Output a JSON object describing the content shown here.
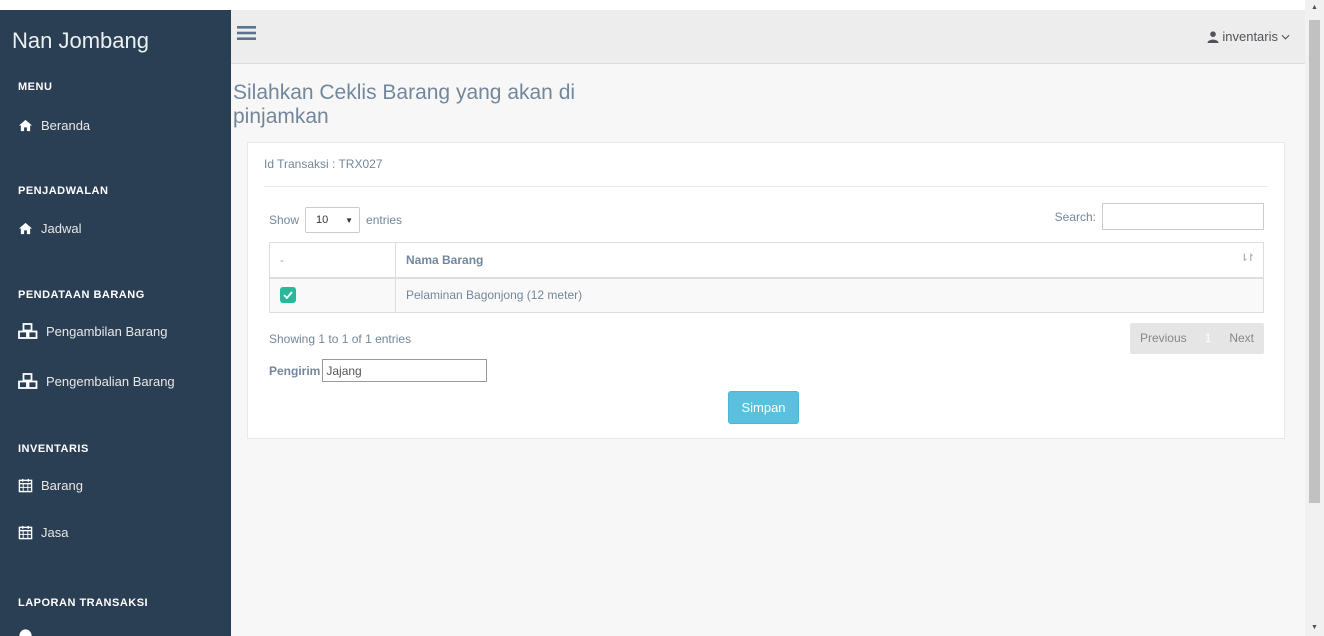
{
  "app": {
    "brand": "Nan Jombang"
  },
  "sidebar": {
    "sections": [
      {
        "title": "MENU",
        "items": [
          {
            "label": "Beranda",
            "icon": "home-icon"
          }
        ]
      },
      {
        "title": "PENJADWALAN",
        "items": [
          {
            "label": "Jadwal",
            "icon": "home-icon"
          }
        ]
      },
      {
        "title": "PENDATAAN BARANG",
        "items": [
          {
            "label": "Pengambilan Barang",
            "icon": "cubes-icon"
          },
          {
            "label": "Pengembalian Barang",
            "icon": "cubes-icon"
          }
        ]
      },
      {
        "title": "INVENTARIS",
        "items": [
          {
            "label": "Barang",
            "icon": "calendar-icon"
          },
          {
            "label": "Jasa",
            "icon": "calendar-icon"
          }
        ]
      },
      {
        "title": "LAPORAN TRANSAKSI",
        "items": []
      }
    ]
  },
  "topbar": {
    "user": "inventaris"
  },
  "page": {
    "title": "Silahkan Ceklis Barang yang akan di pinjamkan",
    "transaction": "Id Transaksi : TRX027"
  },
  "table_controls": {
    "show_label": "Show",
    "page_size": "10",
    "entries_label": "entries",
    "search_label": "Search:",
    "search_value": ""
  },
  "table": {
    "columns": [
      "-",
      "Nama Barang"
    ],
    "rows": [
      {
        "checked": true,
        "nama_barang": "Pelaminan Bagonjong (12 meter)"
      }
    ]
  },
  "pagination": {
    "info": "Showing 1 to 1 of 1 entries",
    "previous": "Previous",
    "current_page": "1",
    "next": "Next"
  },
  "form": {
    "pengirim_label": "Pengirim",
    "pengirim_value": "Jajang",
    "submit_label": "Simpan"
  },
  "colors": {
    "sidebar_bg": "#2a3f54",
    "checkbox": "#26b99a",
    "submit_button": "#5bc0de",
    "title_text": "#73879c"
  }
}
